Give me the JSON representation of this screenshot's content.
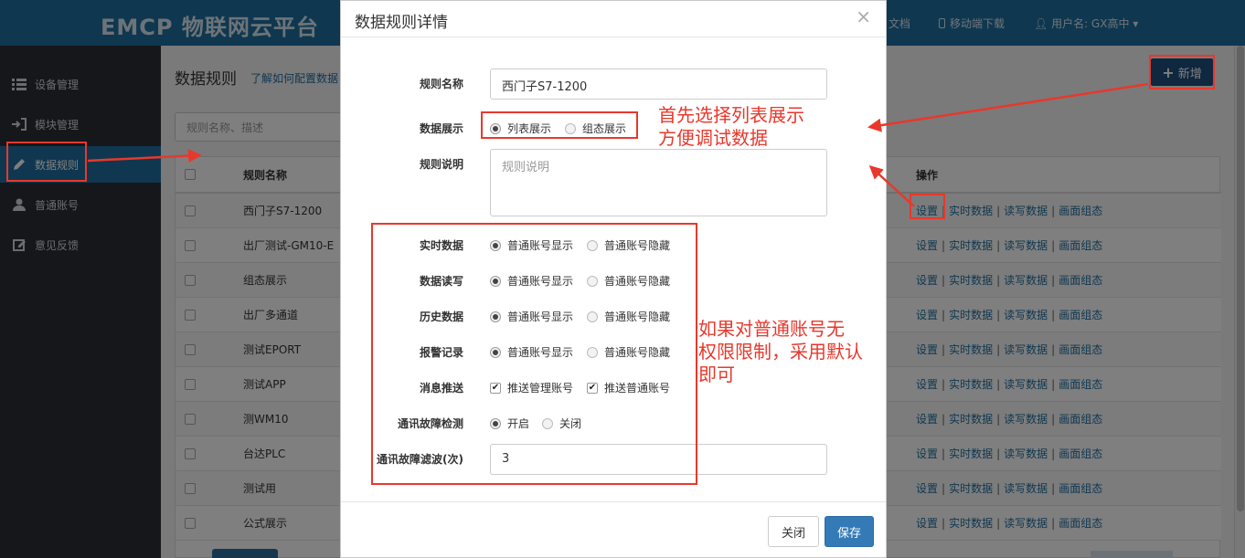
{
  "app": {
    "brand": "EMCP 物联网云平台",
    "top_links": {
      "docs": "文档",
      "mobile": "移动端下载",
      "user": "用户名: GX高中"
    }
  },
  "sidebar": {
    "items": [
      {
        "label": "设备管理",
        "icon": "list-icon"
      },
      {
        "label": "模块管理",
        "icon": "login-icon"
      },
      {
        "label": "数据规则",
        "icon": "pencil-icon",
        "active": true
      },
      {
        "label": "普通账号",
        "icon": "user-icon"
      },
      {
        "label": "意见反馈",
        "icon": "edit-square-icon"
      }
    ]
  },
  "main": {
    "title": "数据规则",
    "help_link": "了解如何配置数据",
    "search_placeholder": "规则名称、描述",
    "add_button": "新增",
    "table": {
      "headers": {
        "name": "规则名称",
        "ops": "操作"
      },
      "ops": [
        "设置",
        "实时数据",
        "读写数据",
        "画面组态"
      ],
      "rows": [
        "西门子S7-1200",
        "出厂测试-GM10-E",
        "组态展示",
        "出厂多通道",
        "测试EPORT",
        "测试APP",
        "测WM10",
        "台达PLC",
        "测试用",
        "公式展示"
      ]
    }
  },
  "modal": {
    "title": "数据规则详情",
    "close_glyph": "×",
    "name_label": "规则名称",
    "name_value": "西门子S7-1200",
    "display_label": "数据展示",
    "display_options": [
      "列表展示",
      "组态展示"
    ],
    "display_selected": "列表展示",
    "desc_label": "规则说明",
    "desc_placeholder": "规则说明",
    "permissions": [
      {
        "label": "实时数据",
        "options": [
          "普通账号显示",
          "普通账号隐藏"
        ],
        "selected": 0
      },
      {
        "label": "数据读写",
        "options": [
          "普通账号显示",
          "普通账号隐藏"
        ],
        "selected": 0
      },
      {
        "label": "历史数据",
        "options": [
          "普通账号显示",
          "普通账号隐藏"
        ],
        "selected": 0
      },
      {
        "label": "报警记录",
        "options": [
          "普通账号显示",
          "普通账号隐藏"
        ],
        "selected": 0
      }
    ],
    "push_label": "消息推送",
    "push_options": [
      "推送管理账号",
      "推送普通账号"
    ],
    "push_checked": [
      true,
      true
    ],
    "fault_label": "通讯故障检测",
    "fault_options": [
      "开启",
      "关闭"
    ],
    "fault_selected": 0,
    "filter_label": "通讯故障滤波(次)",
    "filter_value": "3",
    "close_button": "关闭",
    "save_button": "保存"
  },
  "annotations": {
    "note1": [
      "首先选择列表展示",
      "方便调试数据"
    ],
    "note2": [
      "如果对普通账号无",
      "权限限制，采用默认",
      "即可"
    ],
    "color": "#e8382c"
  },
  "colors": {
    "topbar": "#1f6fa0",
    "sidebar": "#2a2f36",
    "primary": "#337ab7",
    "accent": "#e8382c"
  }
}
